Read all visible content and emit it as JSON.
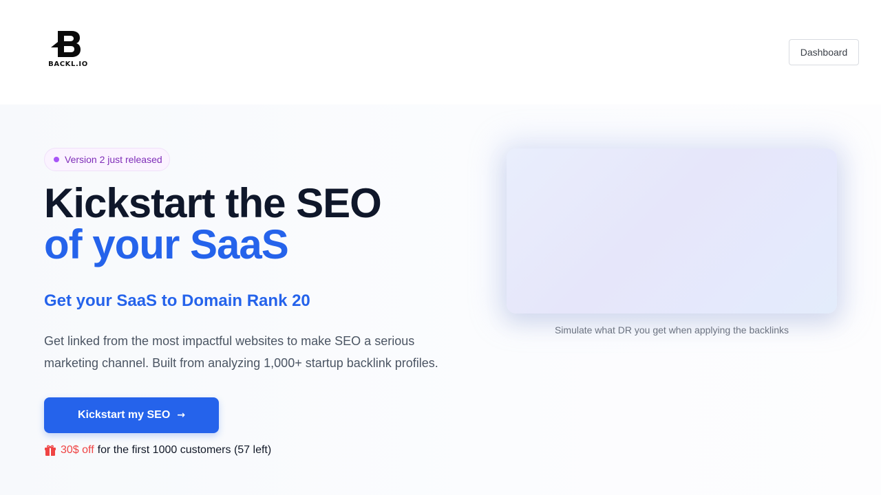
{
  "header": {
    "logo_text": "BACKL.IO",
    "dashboard_label": "Dashboard"
  },
  "hero": {
    "badge_text": "Version 2 just released",
    "headline_line1": "Kickstart the SEO",
    "headline_line2": "of your SaaS",
    "subheadline": "Get your SaaS to Domain Rank 20",
    "description": "Get linked from the most impactful websites to make SEO a serious marketing channel. Built from analyzing 1,000+ startup backlink profiles.",
    "cta_label": "Kickstart my SEO",
    "cta_icon": "arrow-right-icon",
    "offer_icon": "gift-icon",
    "offer_discount": "30$ off",
    "offer_text": "for the first 1000 customers (57 left)"
  },
  "simulator": {
    "caption": "Simulate what DR you get when applying the backlinks"
  },
  "colors": {
    "primary": "#2563eb",
    "badge_accent": "#a855f7",
    "discount": "#ef4444"
  }
}
